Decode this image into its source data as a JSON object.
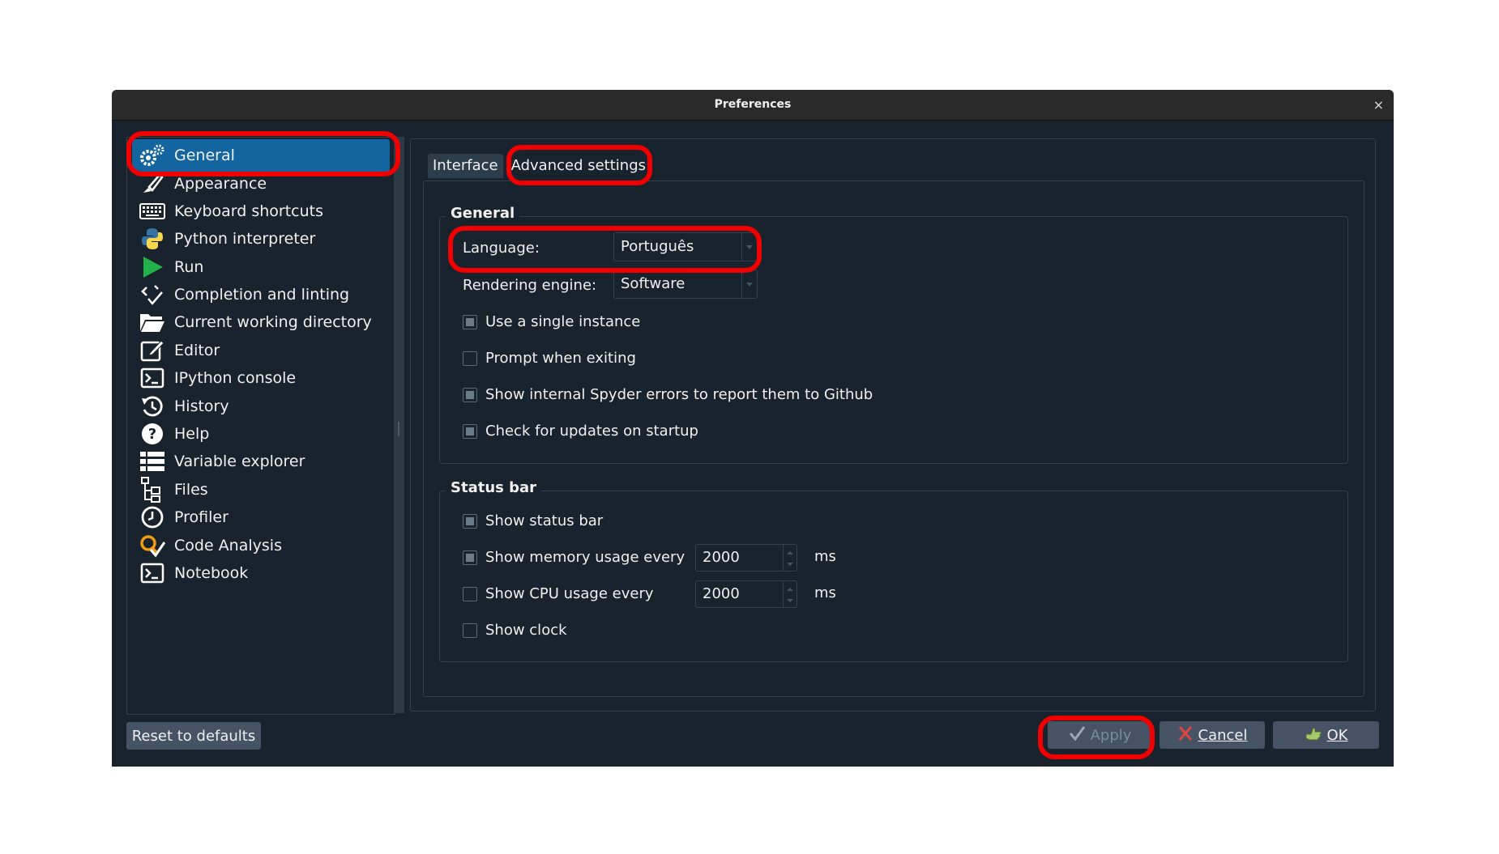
{
  "window": {
    "title": "Preferences",
    "close_glyph": "×"
  },
  "sidebar": {
    "items": [
      {
        "label": "General",
        "icon": "gears-icon",
        "active": true
      },
      {
        "label": "Appearance",
        "icon": "brush-icon"
      },
      {
        "label": "Keyboard shortcuts",
        "icon": "keyboard-icon"
      },
      {
        "label": "Python interpreter",
        "icon": "python-icon"
      },
      {
        "label": "Run",
        "icon": "play-icon"
      },
      {
        "label": "Completion and linting",
        "icon": "code-check-icon"
      },
      {
        "label": "Current working directory",
        "icon": "folder-open-icon"
      },
      {
        "label": "Editor",
        "icon": "edit-icon"
      },
      {
        "label": "IPython console",
        "icon": "terminal-icon"
      },
      {
        "label": "History",
        "icon": "history-icon"
      },
      {
        "label": "Help",
        "icon": "help-icon"
      },
      {
        "label": "Variable explorer",
        "icon": "list-icon"
      },
      {
        "label": "Files",
        "icon": "file-tree-icon"
      },
      {
        "label": "Profiler",
        "icon": "clock-icon"
      },
      {
        "label": "Code Analysis",
        "icon": "code-analysis-icon"
      },
      {
        "label": "Notebook",
        "icon": "notebook-icon"
      }
    ]
  },
  "tabs": [
    {
      "label": "Interface",
      "active": false
    },
    {
      "label": "Advanced settings",
      "active": true
    }
  ],
  "general_group": {
    "title": "General",
    "language_label": "Language:",
    "language_value": "Português",
    "engine_label": "Rendering engine:",
    "engine_value": "Software",
    "checks": [
      {
        "label": "Use a single instance",
        "checked": true
      },
      {
        "label": "Prompt when exiting",
        "checked": false
      },
      {
        "label": "Show internal Spyder errors to report them to Github",
        "checked": true
      },
      {
        "label": "Check for updates on startup",
        "checked": true
      }
    ]
  },
  "statusbar_group": {
    "title": "Status bar",
    "show_status_bar": {
      "label": "Show status bar",
      "checked": true
    },
    "memory": {
      "label": "Show memory usage every",
      "checked": true,
      "value": "2000",
      "unit": "ms"
    },
    "cpu": {
      "label": "Show CPU usage every",
      "checked": false,
      "value": "2000",
      "unit": "ms"
    },
    "clock": {
      "label": "Show clock",
      "checked": false
    }
  },
  "buttons": {
    "reset": "Reset to defaults",
    "apply": "Apply",
    "cancel": "Cancel",
    "ok": "OK"
  },
  "colors": {
    "window_bg": "#19232d",
    "active_item": "#1464a0",
    "highlight": "#f00000",
    "button_bg": "#455364"
  }
}
